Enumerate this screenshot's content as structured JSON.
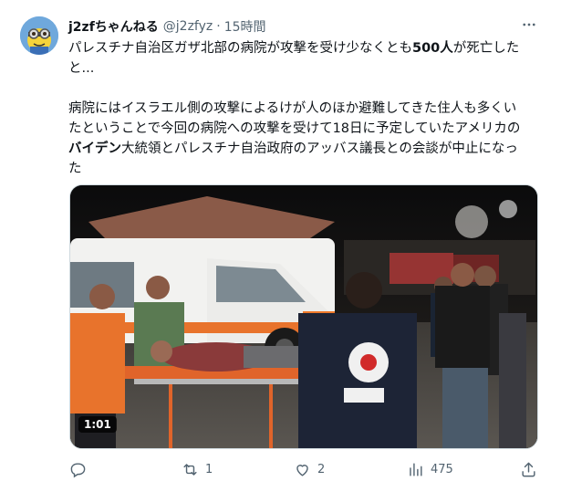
{
  "author": {
    "name": "j2zfちゃんねる",
    "handle": "@j2zfyz",
    "separator": "·",
    "time": "15時間"
  },
  "tweet": {
    "line1_pre": "パレスチナ自治区ガザ北部の病院が攻撃を受け少なくとも",
    "line1_bold": "500人",
    "line1_post": "が死亡した",
    "line2": "と...",
    "para2_a": "病院にはイスラエル側の攻撃によるけが人のほか避難してきた住人も多くい",
    "para2_b": "たということで今回の病院への攻撃を受けて18日に予定していたアメリカの",
    "para2_c_bold": "バイデン",
    "para2_c_rest": "大統領とパレスチナ自治政府のアッバス議長との会談が中止になっ",
    "para2_d": "た"
  },
  "media": {
    "duration": "1:01"
  },
  "actions": {
    "reply_count": "",
    "retweet_count": "1",
    "like_count": "2",
    "views_count": "475"
  },
  "colors": {
    "text": "#0f1419",
    "secondary": "#536471",
    "border": "#cfd9de"
  }
}
